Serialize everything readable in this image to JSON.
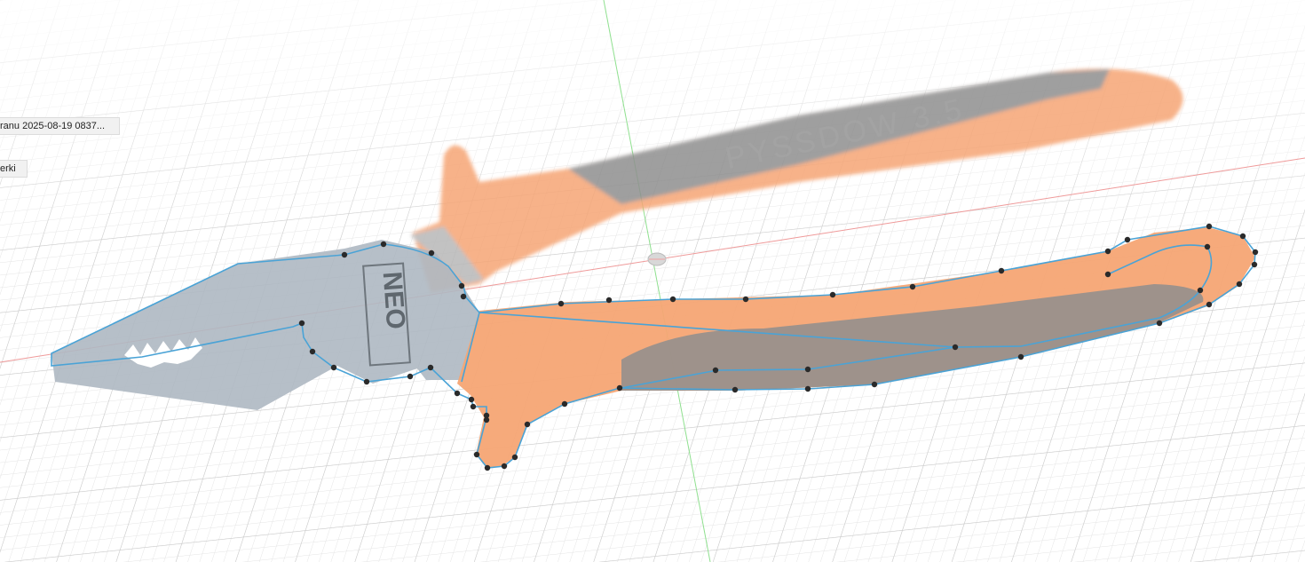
{
  "canvas": {
    "background": "#ffffff",
    "grid_minor_color": "#e2e2e2",
    "grid_major_color": "#c4c4c4",
    "x_axis_color": "#ef8a8a",
    "y_axis_color": "#8ee08e"
  },
  "browser": {
    "items": [
      {
        "label": "ranu 2025-08-19 0837..."
      },
      {
        "label": "erki"
      }
    ]
  },
  "canvas_image": {
    "handle_text": "PYSSDOW 3.5",
    "logo_text": "NEO"
  },
  "colors": {
    "sketch_line": "#4aa3d6",
    "handle_orange": "#f4a470",
    "handle_gray": "#8f8f8f",
    "steel": "#a8b4bf",
    "point": "#2a2a2a"
  },
  "icons": {
    "origin": "origin-marker-icon",
    "sketch_point": "sketch-point-icon"
  }
}
